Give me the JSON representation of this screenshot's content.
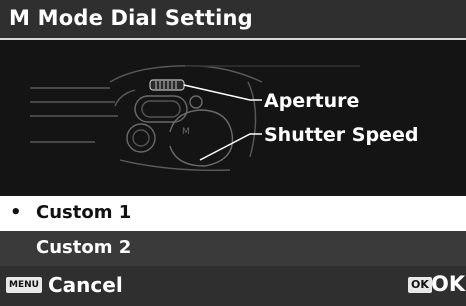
{
  "header": {
    "title": "M Mode Dial Setting"
  },
  "illustration": {
    "callouts": [
      "Aperture",
      "Shutter Speed"
    ],
    "dial_mark": "M"
  },
  "options": {
    "items": [
      {
        "bullet": "•",
        "label": "Custom 1",
        "selected": true
      },
      {
        "bullet": "",
        "label": "Custom 2",
        "selected": false
      }
    ]
  },
  "footer": {
    "menu_key": "MENU",
    "cancel_label": "Cancel",
    "ok_key": "OK",
    "ok_label": "OK"
  },
  "colors": {
    "background": "#141414",
    "bar": "#2f2f2f",
    "selected_row": "#ffffff",
    "unselected_row": "#3a3a3a"
  }
}
